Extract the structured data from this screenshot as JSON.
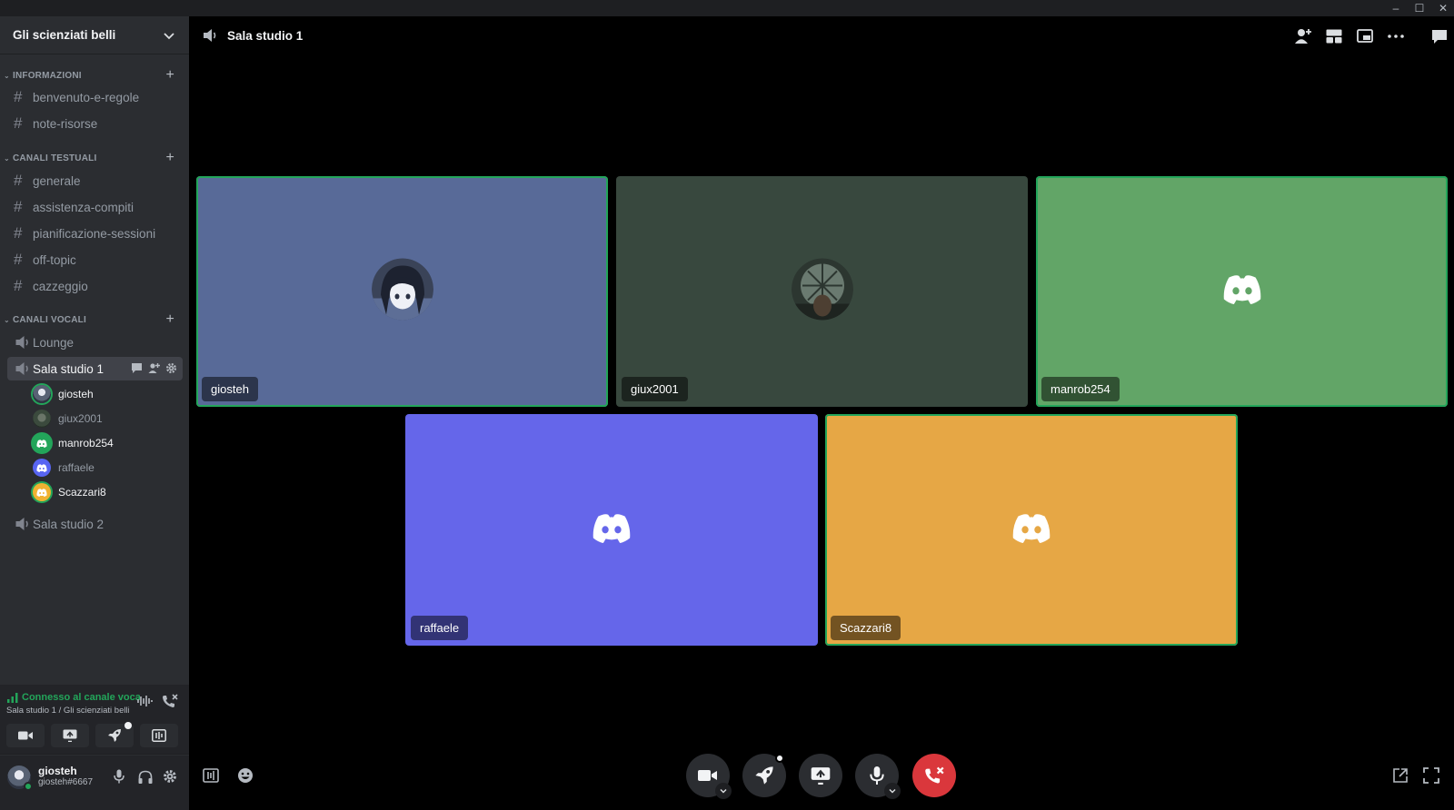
{
  "window": {
    "minimize": "–",
    "maximize": "☐",
    "close": "✕"
  },
  "server": {
    "name": "Gli scienziati belli"
  },
  "categories": [
    {
      "label": "INFORMAZIONI"
    },
    {
      "label": "CANALI TESTUALI"
    },
    {
      "label": "CANALI VOCALI"
    }
  ],
  "info_channels": [
    "benvenuto-e-regole",
    "note-risorse"
  ],
  "text_channels": [
    "generale",
    "assistenza-compiti",
    "pianificazione-sessioni",
    "off-topic",
    "cazzeggio"
  ],
  "voice_channels": [
    "Lounge",
    "Sala studio 1",
    "Sala studio 2"
  ],
  "voice_users": [
    {
      "name": "giosteh",
      "avatar": "anime-avatar"
    },
    {
      "name": "giux2001",
      "avatar": "photo-avatar"
    },
    {
      "name": "manrob254",
      "avatar": "discord-logo",
      "color": "#23a55a"
    },
    {
      "name": "raffaele",
      "avatar": "discord-logo",
      "color": "#5865f2"
    },
    {
      "name": "Scazzari8",
      "avatar": "discord-logo",
      "color": "#f0b232"
    }
  ],
  "voice_panel": {
    "status": "Connesso al canale vocale",
    "location": "Sala studio 1 / Gli scienziati belli"
  },
  "user": {
    "name": "giosteh",
    "tag": "giosteh#6667"
  },
  "main": {
    "channel_title": "Sala studio 1"
  },
  "tiles": [
    {
      "name": "giosteh",
      "bg": "#586a98",
      "speaking": true,
      "icon": "anime-avatar"
    },
    {
      "name": "giux2001",
      "bg": "#38483e",
      "speaking": false,
      "icon": "photo-avatar"
    },
    {
      "name": "manrob254",
      "bg": "#62a567",
      "speaking": true,
      "icon": "discord-logo"
    },
    {
      "name": "raffaele",
      "bg": "#6566ea",
      "speaking": false,
      "icon": "discord-logo"
    },
    {
      "name": "Scazzari8",
      "bg": "#e6a745",
      "speaking": true,
      "icon": "discord-logo"
    }
  ],
  "colors": {
    "accent_green": "#23a55a",
    "danger": "#da373c",
    "sidebar": "#2b2d31"
  }
}
